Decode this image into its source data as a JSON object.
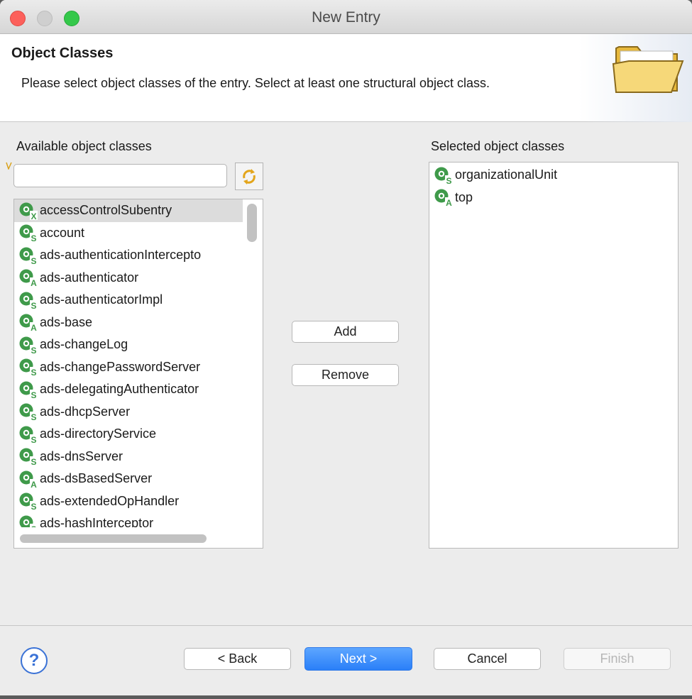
{
  "window": {
    "title": "New Entry"
  },
  "header": {
    "title": "Object Classes",
    "description": "Please select object classes of the entry. Select at least one structural object class.",
    "icon": "folder-icon"
  },
  "available": {
    "label": "Available object classes",
    "filter_value": "",
    "refresh_icon": "refresh-icon",
    "items": [
      {
        "name": "accessControlSubentry",
        "kind": "X"
      },
      {
        "name": "account",
        "kind": "S"
      },
      {
        "name": "ads-authenticationIntercepto",
        "kind": "S"
      },
      {
        "name": "ads-authenticator",
        "kind": "A"
      },
      {
        "name": "ads-authenticatorImpl",
        "kind": "S"
      },
      {
        "name": "ads-base",
        "kind": "A"
      },
      {
        "name": "ads-changeLog",
        "kind": "S"
      },
      {
        "name": "ads-changePasswordServer",
        "kind": "S"
      },
      {
        "name": "ads-delegatingAuthenticator",
        "kind": "S"
      },
      {
        "name": "ads-dhcpServer",
        "kind": "S"
      },
      {
        "name": "ads-directoryService",
        "kind": "S"
      },
      {
        "name": "ads-dnsServer",
        "kind": "S"
      },
      {
        "name": "ads-dsBasedServer",
        "kind": "A"
      },
      {
        "name": "ads-extendedOpHandler",
        "kind": "S"
      },
      {
        "name": "ads-hashInterceptor",
        "kind": "S"
      }
    ]
  },
  "selected": {
    "label": "Selected object classes",
    "items": [
      {
        "name": "organizationalUnit",
        "kind": "S"
      },
      {
        "name": "top",
        "kind": "A"
      }
    ]
  },
  "actions": {
    "add": "Add",
    "remove": "Remove"
  },
  "footer": {
    "help": "?",
    "back": "< Back",
    "next": "Next >",
    "cancel": "Cancel",
    "finish": "Finish"
  },
  "colors": {
    "icon_green": "#3f9a4a",
    "primary_button": "#2a7ff8"
  }
}
